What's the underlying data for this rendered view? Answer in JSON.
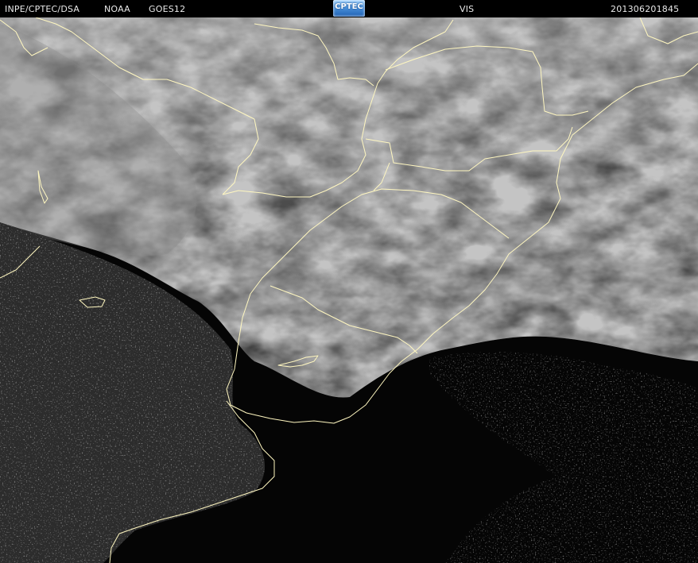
{
  "header": {
    "institution": "INPE/CPTEC/DSA",
    "agency": "NOAA",
    "satellite": "GOES12",
    "logo_text": "CPTEC",
    "channel": "VIS",
    "timestamp": "201306201845"
  },
  "colors": {
    "background": "#000000",
    "header_text": "#e8e8e8",
    "boundary_lines": "#fff7c0",
    "cloud_light": "#8a8a8a",
    "cloud_dark": "#2a2a2a"
  }
}
